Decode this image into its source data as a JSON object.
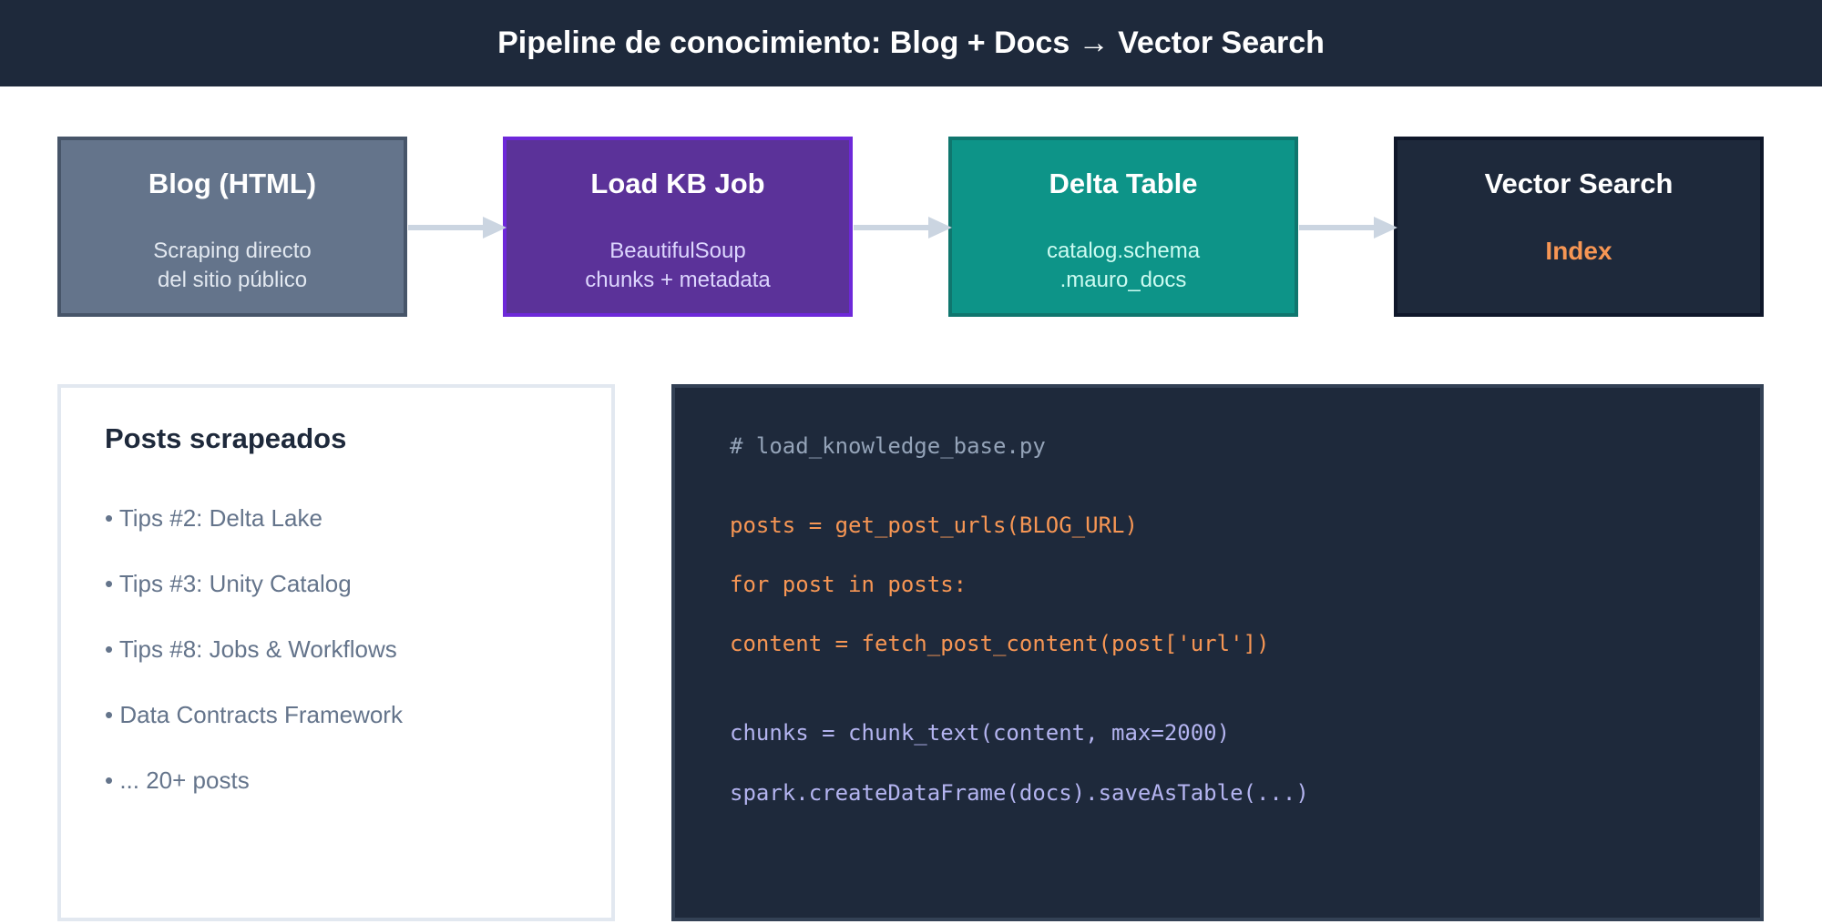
{
  "header": {
    "title": "Pipeline de conocimiento: Blog + Docs → Vector Search"
  },
  "nodes": [
    {
      "title": "Blog (HTML)",
      "lines": [
        "Scraping directo",
        "del sitio público"
      ]
    },
    {
      "title": "Load KB Job",
      "lines": [
        "BeautifulSoup",
        "chunks + metadata"
      ]
    },
    {
      "title": "Delta Table",
      "lines": [
        "catalog.schema",
        ".mauro_docs"
      ]
    },
    {
      "title": "Vector Search",
      "accent": "Index"
    }
  ],
  "posts": {
    "title": "Posts scrapeados",
    "items": [
      "• Tips #2: Delta Lake",
      "• Tips #3: Unity Catalog",
      "• Tips #8: Jobs & Workflows",
      "• Data Contracts Framework",
      "• ... 20+ posts"
    ]
  },
  "code": {
    "comment": "# load_knowledge_base.py",
    "lines": [
      "posts = get_post_urls(BLOG_URL)",
      "for post in posts:",
      "content = fetch_post_content(post['url'])",
      "chunks = chunk_text(content, max=2000)",
      "spark.createDataFrame(docs).saveAsTable(...)"
    ]
  },
  "colors": {
    "header_bg": "#1e293b",
    "blog_node": "#64748b",
    "job_node": "#5b3299",
    "delta_node": "#0d9488",
    "vector_node": "#1e293b",
    "accent_orange": "#f79654",
    "code_lavender": "#b4b4f0",
    "arrow": "#cbd5e1"
  }
}
